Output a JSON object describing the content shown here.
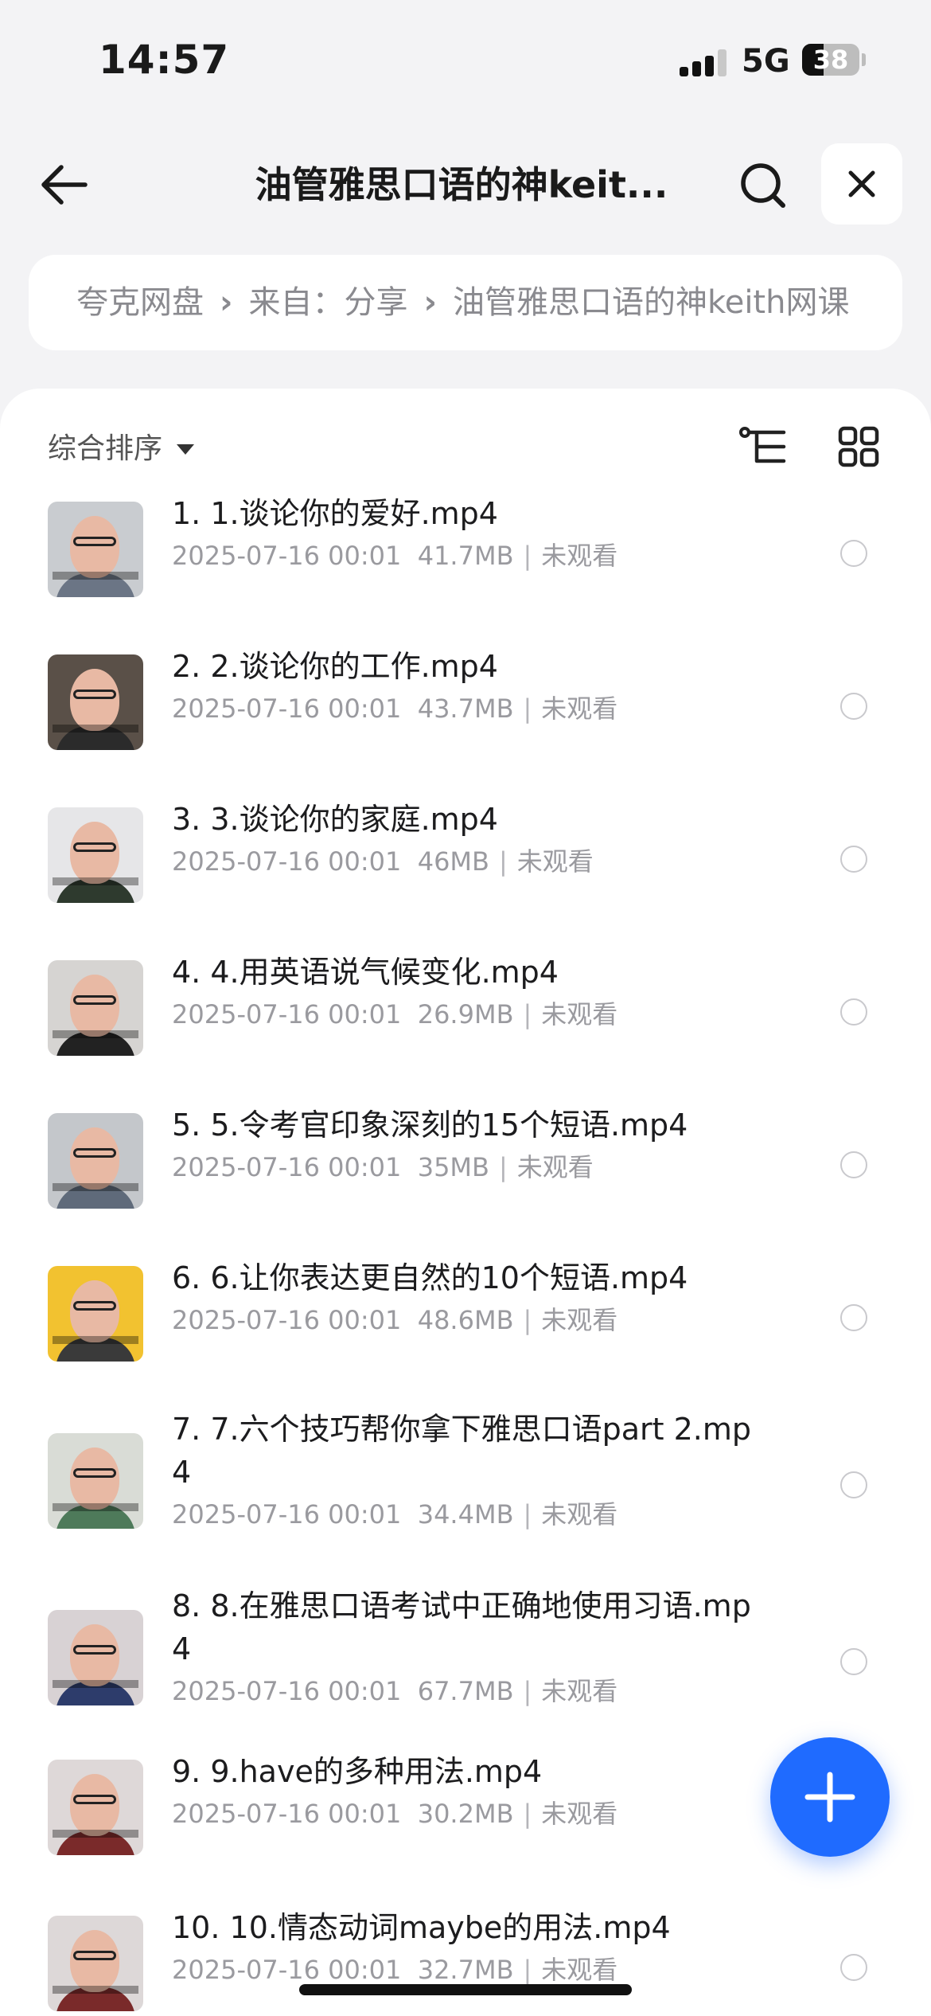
{
  "status_bar": {
    "time": "14:57",
    "network": "5G",
    "battery": "38",
    "battery_level": 0.38
  },
  "header": {
    "title": "油管雅思口语的神keit..."
  },
  "breadcrumb": [
    "夸克网盘",
    "来自：分享",
    "油管雅思口语的神keith网课"
  ],
  "toolbar": {
    "sort_label": "综合排序"
  },
  "files": [
    {
      "index": "1",
      "name": "1. 1.谈论你的爱好.mp4",
      "date": "2025-07-16 00:01",
      "size": "41.7MB",
      "status": "未观看",
      "thumb_bg": "#c9ccd0",
      "shirt": "#6b7585"
    },
    {
      "index": "2",
      "name": "2. 2.谈论你的工作.mp4",
      "date": "2025-07-16 00:01",
      "size": "43.7MB",
      "status": "未观看",
      "thumb_bg": "#5a5048",
      "shirt": "#2b2b2b"
    },
    {
      "index": "3",
      "name": "3. 3.谈论你的家庭.mp4",
      "date": "2025-07-16 00:01",
      "size": "46MB",
      "status": "未观看",
      "thumb_bg": "#e6e6e8",
      "shirt": "#2e3a2e"
    },
    {
      "index": "4",
      "name": "4. 4.用英语说气候变化.mp4",
      "date": "2025-07-16 00:01",
      "size": "26.9MB",
      "status": "未观看",
      "thumb_bg": "#d6d4d2",
      "shirt": "#222222"
    },
    {
      "index": "5",
      "name": "5. 5.令考官印象深刻的15个短语.mp4",
      "date": "2025-07-16 00:01",
      "size": "35MB",
      "status": "未观看",
      "thumb_bg": "#c4c7cb",
      "shirt": "#5f6a7a"
    },
    {
      "index": "6",
      "name": "6. 6.让你表达更自然的10个短语.mp4",
      "date": "2025-07-16 00:01",
      "size": "48.6MB",
      "status": "未观看",
      "thumb_bg": "#f2c230",
      "shirt": "#3a3a3a"
    },
    {
      "index": "7",
      "name": "7. 7.六个技巧帮你拿下雅思口语part 2.mp4",
      "date": "2025-07-16 00:01",
      "size": "34.4MB",
      "status": "未观看",
      "thumb_bg": "#d9dcd6",
      "shirt": "#4e7a5a"
    },
    {
      "index": "8",
      "name": "8. 8.在雅思口语考试中正确地使用习语.mp4",
      "date": "2025-07-16 00:01",
      "size": "67.7MB",
      "status": "未观看",
      "thumb_bg": "#d8d2d4",
      "shirt": "#2d3c6b"
    },
    {
      "index": "9",
      "name": "9. 9.have的多种用法.mp4",
      "date": "2025-07-16 00:01",
      "size": "30.2MB",
      "status": "未观看",
      "thumb_bg": "#ded8d8",
      "shirt": "#7a2a2a"
    },
    {
      "index": "10",
      "name": "10. 10.情态动词maybe的用法.mp4",
      "date": "2025-07-16 00:01",
      "size": "32.7MB",
      "status": "未观看",
      "thumb_bg": "#ddd8d8",
      "shirt": "#7a2a2a"
    }
  ],
  "colors": {
    "accent": "#1f6bff",
    "background": "#f3f3f5",
    "meta_text": "#9a9a9f"
  }
}
